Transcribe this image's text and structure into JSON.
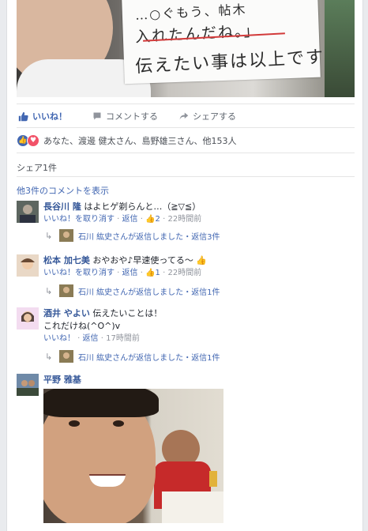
{
  "post": {
    "photo_text": [
      "…○ぐもう、帖木",
      "入れたんだね。」",
      "伝えたい事は以上です!"
    ],
    "actions": {
      "like": "いいね！",
      "comment": "コメントする",
      "share": "シェアする"
    },
    "reactions_text": "あなた、渡邊 健太さん、島野雄三さん、他153人",
    "shares_text": "シェア1件",
    "more_comments": "他3件のコメントを表示"
  },
  "comments": [
    {
      "name": "長谷川 隆",
      "text": "はよヒゲ剃らんと…（≧▽≦）",
      "unlike": "いいね！を取り消す",
      "reply": "返信",
      "likes": "2",
      "time": "22時間前",
      "reply_summary": {
        "name": "石川 紘史さんが返信しました",
        "sep": "・",
        "count": "返信3件"
      }
    },
    {
      "name": "松本 加七美",
      "text": "おやおや♪早速使ってる〜",
      "unlike": "いいね！を取り消す",
      "reply": "返信",
      "likes": "1",
      "time": "22時間前",
      "reply_summary": {
        "name": "石川 紘史さんが返信しました",
        "sep": "・",
        "count": "返信1件"
      }
    },
    {
      "name": "酒井 やよい",
      "text": "伝えたいことは！",
      "text2": "これだけね(^O^)v",
      "like": "いいね！",
      "reply": "返信",
      "time": "17時間前",
      "reply_summary": {
        "name": "石川 紘史さんが返信しました",
        "sep": "・",
        "count": "返信1件"
      }
    },
    {
      "name": "平野 雅基"
    }
  ],
  "colors": {
    "link": "#4267b2",
    "name": "#365899",
    "meta": "#90949c",
    "bg": "#e9ebee"
  },
  "icons": [
    "thumbs-up-icon",
    "comment-icon",
    "share-icon",
    "heart-icon",
    "reply-arrow-icon"
  ]
}
